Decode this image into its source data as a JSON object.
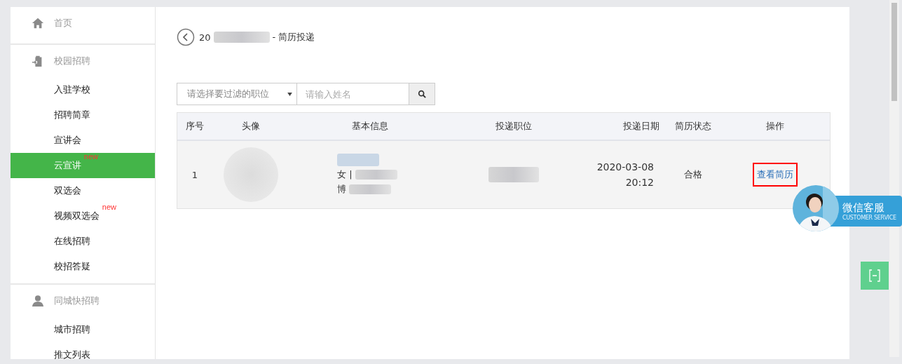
{
  "sidebar": {
    "sections": [
      {
        "title": "首页"
      },
      {
        "title": "校园招聘",
        "items": [
          {
            "label": "入驻学校",
            "selected": false
          },
          {
            "label": "招聘简章",
            "selected": false
          },
          {
            "label": "宣讲会",
            "selected": false
          },
          {
            "label": "云宣讲",
            "selected": true,
            "badge": "new"
          },
          {
            "label": "双选会",
            "selected": false
          },
          {
            "label": "视频双选会",
            "selected": false,
            "badge": "new"
          },
          {
            "label": "在线招聘",
            "selected": false
          },
          {
            "label": "校招答疑",
            "selected": false
          }
        ]
      },
      {
        "title": "同城快招聘",
        "items": [
          {
            "label": "城市招聘",
            "selected": false
          },
          {
            "label": "推文列表",
            "selected": false
          }
        ]
      }
    ]
  },
  "header": {
    "title_start": "20",
    "title_end": "- 简历投递"
  },
  "filter": {
    "select_placeholder": "请选择要过滤的职位",
    "name_placeholder": "请输入姓名"
  },
  "table": {
    "columns": [
      "序号",
      "头像",
      "基本信息",
      "投递职位",
      "投递日期",
      "简历状态",
      "操作"
    ],
    "rows": [
      {
        "index": "1",
        "gender": "女 |",
        "degree": "博",
        "date": "2020-03-08",
        "time": "20:12",
        "status": "合格",
        "action": "查看简历"
      }
    ]
  },
  "service": {
    "title": "微信客服",
    "subtitle": "CUSTOMER SERVICE"
  }
}
